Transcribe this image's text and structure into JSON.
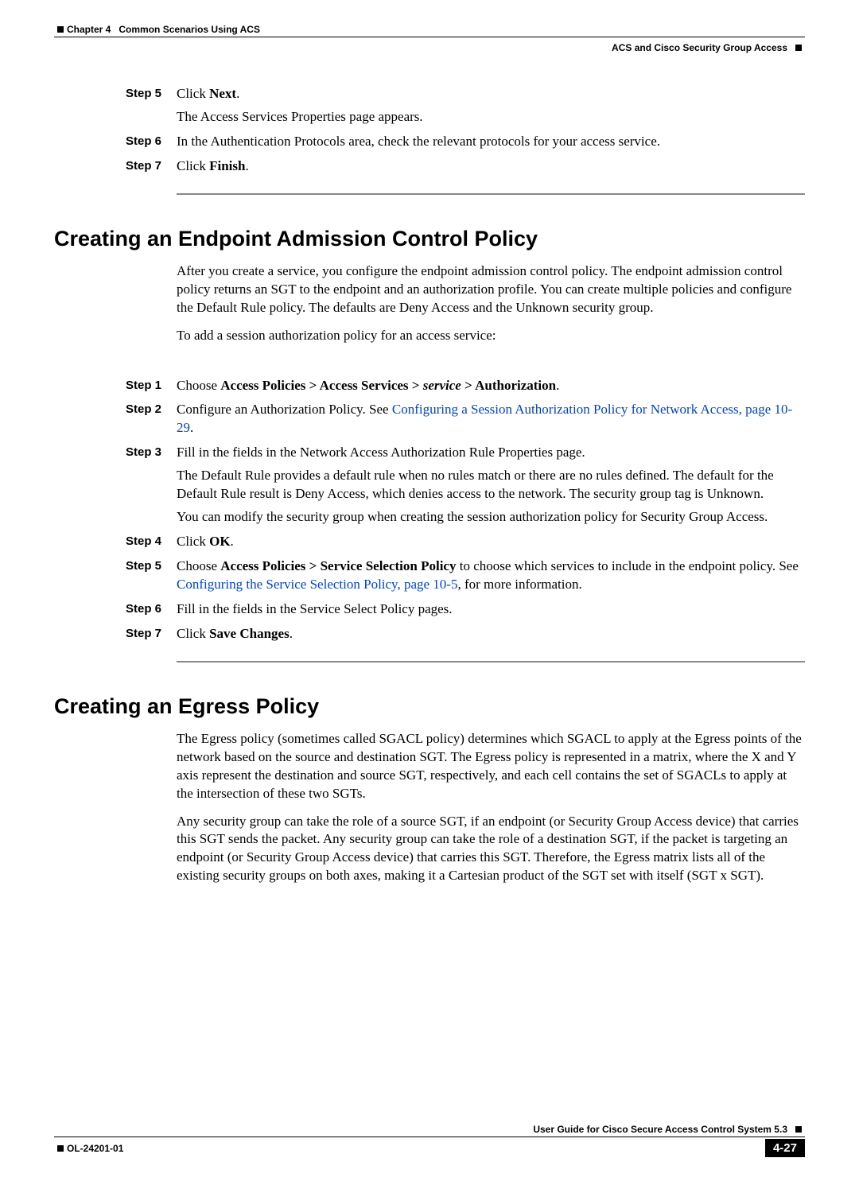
{
  "header": {
    "chapter": "Chapter 4",
    "chapterTitle": "Common Scenarios Using ACS",
    "sectionTitle": "ACS and Cisco Security Group Access"
  },
  "stepsA": [
    {
      "label": "Step 5",
      "parts": [
        {
          "type": "text",
          "text": "Click "
        },
        {
          "type": "bold",
          "text": "Next"
        },
        {
          "type": "text",
          "text": "."
        }
      ],
      "extra": [
        "The Access Services Properties page appears."
      ]
    },
    {
      "label": "Step 6",
      "parts": [
        {
          "type": "text",
          "text": "In the Authentication Protocols area, check the relevant protocols for your access service."
        }
      ]
    },
    {
      "label": "Step 7",
      "parts": [
        {
          "type": "text",
          "text": "Click "
        },
        {
          "type": "bold",
          "text": "Finish"
        },
        {
          "type": "text",
          "text": "."
        }
      ]
    }
  ],
  "section1": {
    "heading": "Creating an Endpoint Admission Control Policy",
    "paras": [
      "After you create a service, you configure the endpoint admission control policy. The endpoint admission control policy returns an SGT to the endpoint and an authorization profile. You can create multiple policies and configure the Default Rule policy. The defaults are Deny Access and the Unknown security group.",
      "To add a session authorization policy for an access service:"
    ],
    "steps": [
      {
        "label": "Step 1",
        "parts": [
          {
            "type": "text",
            "text": "Choose "
          },
          {
            "type": "bold",
            "text": "Access Policies > Access Services > "
          },
          {
            "type": "bolditalic",
            "text": "service"
          },
          {
            "type": "bold",
            "text": " > Authorization"
          },
          {
            "type": "text",
            "text": "."
          }
        ]
      },
      {
        "label": "Step 2",
        "parts": [
          {
            "type": "text",
            "text": "Configure an Authorization Policy. See "
          },
          {
            "type": "link",
            "text": "Configuring a Session Authorization Policy for Network Access, page 10-29"
          },
          {
            "type": "text",
            "text": "."
          }
        ]
      },
      {
        "label": "Step 3",
        "parts": [
          {
            "type": "text",
            "text": "Fill in the fields in the Network Access Authorization Rule Properties page."
          }
        ],
        "extra": [
          "The Default Rule provides a default rule when no rules match or there are no rules defined. The default for the Default Rule result is Deny Access, which denies access to the network. The security group tag is Unknown.",
          "You can modify the security group when creating the session authorization policy for Security Group Access."
        ]
      },
      {
        "label": "Step 4",
        "parts": [
          {
            "type": "text",
            "text": "Click "
          },
          {
            "type": "bold",
            "text": "OK"
          },
          {
            "type": "text",
            "text": "."
          }
        ]
      },
      {
        "label": "Step 5",
        "parts": [
          {
            "type": "text",
            "text": "Choose "
          },
          {
            "type": "bold",
            "text": "Access Policies > Service Selection Policy"
          },
          {
            "type": "text",
            "text": " to choose which services to include in the endpoint policy. See "
          },
          {
            "type": "link",
            "text": "Configuring the Service Selection Policy, page 10-5"
          },
          {
            "type": "text",
            "text": ", for more information."
          }
        ]
      },
      {
        "label": "Step 6",
        "parts": [
          {
            "type": "text",
            "text": "Fill in the fields in the Service Select Policy pages."
          }
        ]
      },
      {
        "label": "Step 7",
        "parts": [
          {
            "type": "text",
            "text": "Click "
          },
          {
            "type": "bold",
            "text": "Save Changes"
          },
          {
            "type": "text",
            "text": "."
          }
        ]
      }
    ]
  },
  "section2": {
    "heading": "Creating an Egress Policy",
    "paras": [
      "The Egress policy (sometimes called SGACL policy) determines which SGACL to apply at the Egress points of the network based on the source and destination SGT. The Egress policy is represented in a matrix, where the X and Y axis represent the destination and source SGT, respectively, and each cell contains the set of SGACLs to apply at the intersection of these two SGTs.",
      "Any security group can take the role of a source SGT, if an endpoint (or Security Group Access device) that carries this SGT sends the packet. Any security group can take the role of a destination SGT, if the packet is targeting an endpoint (or Security Group Access device) that carries this SGT. Therefore, the Egress matrix lists all of the existing security groups on both axes, making it a Cartesian product of the SGT set with itself (SGT x SGT)."
    ]
  },
  "footer": {
    "docTitle": "User Guide for Cisco Secure Access Control System 5.3",
    "docId": "OL-24201-01",
    "pageNum": "4-27"
  }
}
